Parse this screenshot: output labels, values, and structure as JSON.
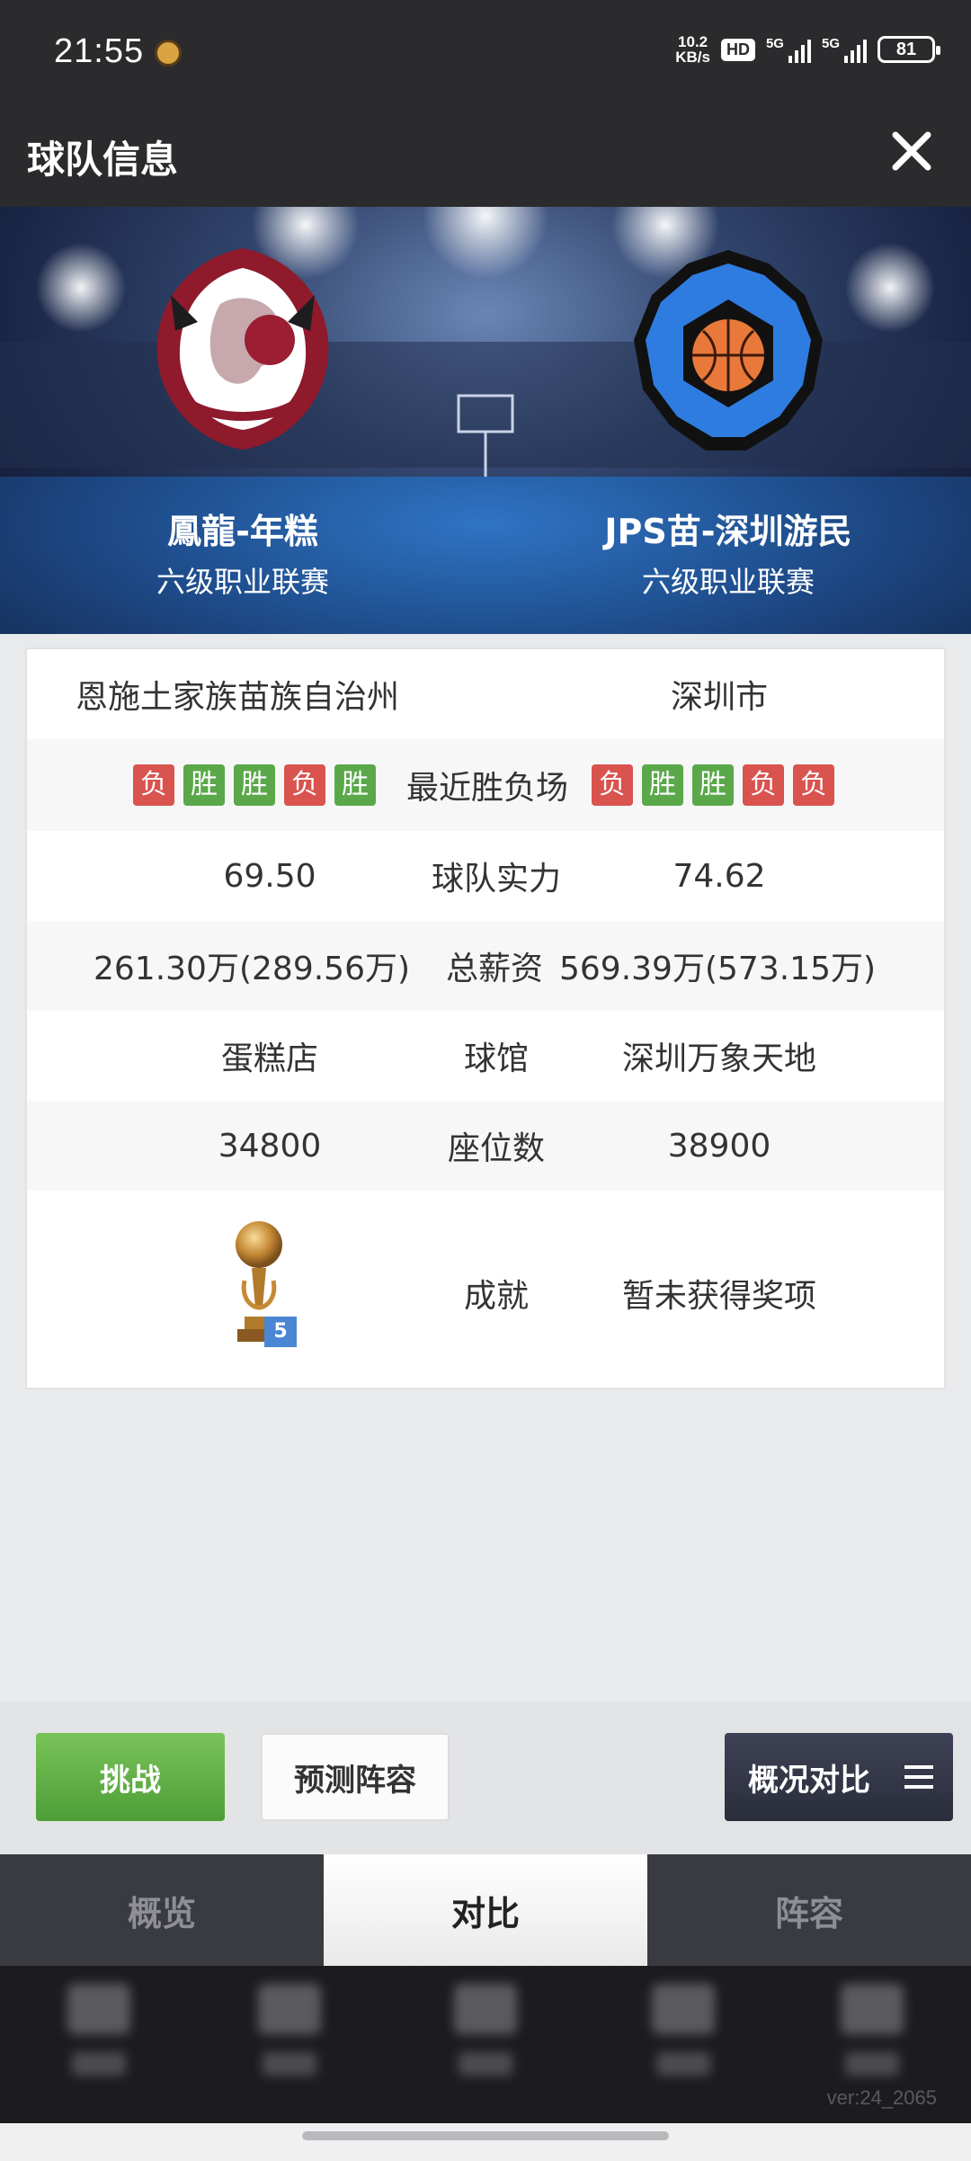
{
  "status_bar": {
    "time": "21:55",
    "net_speed_value": "10.2",
    "net_speed_unit": "KB/s",
    "hd_label": "HD",
    "signal1_label": "5G",
    "signal2_label": "5G",
    "battery": "81"
  },
  "header": {
    "title": "球队信息",
    "close_icon": "close-icon"
  },
  "teams": {
    "home": {
      "name": "鳳龍-年糕",
      "league": "六级职业联赛"
    },
    "away": {
      "name": "JPS苗-深圳游民",
      "league": "六级职业联赛"
    }
  },
  "compare": {
    "location": {
      "home": "恩施土家族苗族自治州",
      "away": "深圳市"
    },
    "recent": {
      "label": "最近胜负场",
      "home": [
        "负",
        "胜",
        "胜",
        "负",
        "胜"
      ],
      "away": [
        "负",
        "胜",
        "胜",
        "负",
        "负"
      ]
    },
    "strength": {
      "label": "球队实力",
      "home": "69.50",
      "away": "74.62"
    },
    "salary": {
      "label": "总薪资",
      "home": "261.30万(289.56万)",
      "away": "569.39万(573.15万)"
    },
    "arena": {
      "label": "球馆",
      "home": "蛋糕店",
      "away": "深圳万象天地"
    },
    "seats": {
      "label": "座位数",
      "home": "34800",
      "away": "38900"
    },
    "achievement": {
      "label": "成就",
      "home_trophy_count": "5",
      "away": "暂未获得奖项"
    }
  },
  "actions": {
    "challenge": "挑战",
    "predict_lineup": "预测阵容",
    "overview_compare": "概况对比"
  },
  "tabs": [
    "概览",
    "对比",
    "阵容"
  ],
  "active_tab": "对比",
  "version": "ver:24_2065",
  "colors": {
    "lose": "#d9534f",
    "win": "#5aa84a",
    "header_bg": "#2b2b2d",
    "challenge_green": "#5aa84a"
  }
}
